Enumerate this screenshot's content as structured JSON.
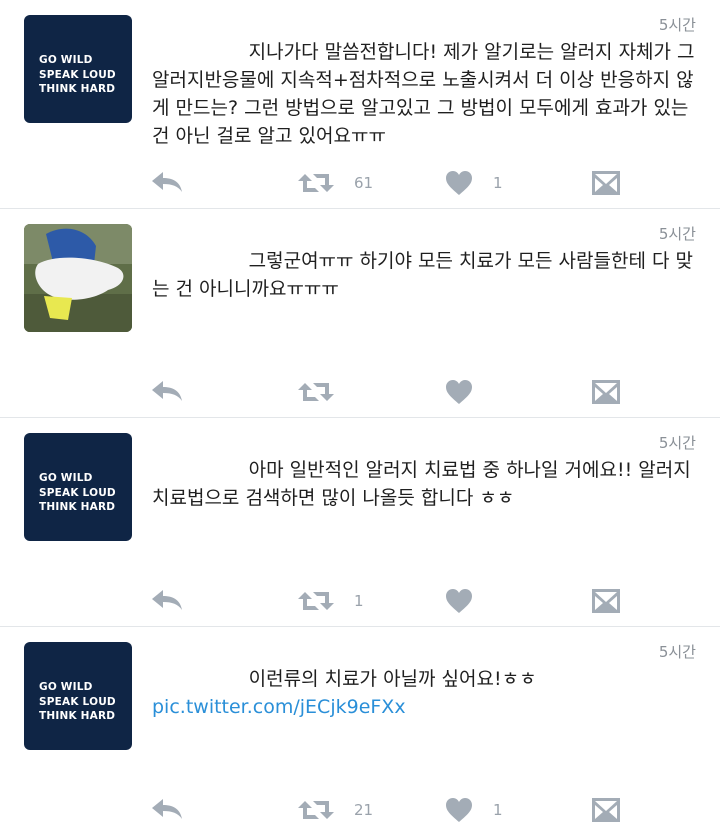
{
  "tweets": [
    {
      "avatar_type": "logo",
      "avatar_text": [
        "GO WILD",
        "SPEAK LOUD",
        "THINK HARD"
      ],
      "time": "5시간",
      "text": "                지나가다 말씀전합니다! 제가 알기로는 알러지 자체가 그 알러지반응물에 지속적+점차적으로 노출시켜서 더 이상 반응하지 않게 만드는? 그런 방법으로 알고있고 그 방법이 모두에게 효과가 있는 건 아닌 걸로 알고 있어요ㅠㅠ",
      "link": "",
      "retweets": "61",
      "likes": "1"
    },
    {
      "avatar_type": "photo",
      "avatar_text": [],
      "time": "5시간",
      "text": "                그렇군여ㅠㅠ 하기야 모든 치료가 모든 사람들한테 다 맞는 건 아니니까요ㅠㅠㅠ",
      "link": "",
      "retweets": "",
      "likes": ""
    },
    {
      "avatar_type": "logo",
      "avatar_text": [
        "GO WILD",
        "SPEAK LOUD",
        "THINK HARD"
      ],
      "time": "5시간",
      "text": "                아마 일반적인 알러지 치료법 중 하나일 거에요!! 알러지 치료법으로 검색하면 많이 나올듯 합니다 ㅎㅎ",
      "link": "",
      "retweets": "1",
      "likes": ""
    },
    {
      "avatar_type": "logo",
      "avatar_text": [
        "GO WILD",
        "SPEAK LOUD",
        "THINK HARD"
      ],
      "time": "5시간",
      "text": "                이런류의 치료가 아닐까 싶어요!ㅎㅎ",
      "link": "pic.twitter.com/jECjk9eFXx",
      "retweets": "21",
      "likes": "1"
    }
  ],
  "icons": {
    "reply": "reply-icon",
    "retweet": "retweet-icon",
    "like": "heart-icon",
    "dm": "direct-message-icon"
  },
  "colors": {
    "icon": "#a3acb6",
    "time": "#8a9097",
    "link": "#2a8fd8",
    "avatar_bg": "#0f2545"
  }
}
